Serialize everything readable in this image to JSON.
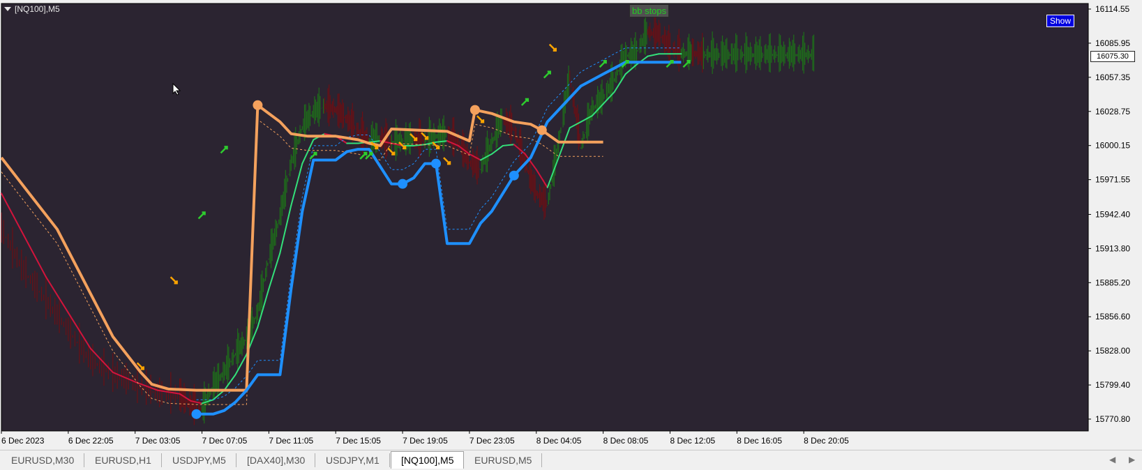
{
  "window": {
    "symbol_label": "[NQ100],M5"
  },
  "indicator_label": "bb stops",
  "show_button": "Show",
  "current_price": "16075.30",
  "colors": {
    "background": "#2b2431",
    "up_candle": "#1e6e1a",
    "down_candle": "#6b0f14",
    "upper_stop": "#f4a15d",
    "lower_stop": "#1e90ff",
    "mid_up": "#33e07a",
    "mid_down": "#d2143c",
    "arrow_up": "#2ecc2e",
    "arrow_down": "#ffa500"
  },
  "tabs": [
    {
      "label": "EURUSD,M30",
      "active": false
    },
    {
      "label": "EURUSD,H1",
      "active": false
    },
    {
      "label": "USDJPY,M5",
      "active": false
    },
    {
      "label": "[DAX40],M30",
      "active": false
    },
    {
      "label": "USDJPY,M1",
      "active": false
    },
    {
      "label": "[NQ100],M5",
      "active": true
    },
    {
      "label": "EURUSD,M5",
      "active": false
    }
  ],
  "chart_data": {
    "type": "line",
    "title": "[NQ100],M5",
    "y_ticks": [
      "16114.55",
      "16085.95",
      "16057.35",
      "16028.75",
      "16000.15",
      "15971.55",
      "15942.40",
      "15913.80",
      "15885.20",
      "15856.60",
      "15828.00",
      "15799.40",
      "15770.80"
    ],
    "x_ticks": [
      "6 Dec 2023",
      "6 Dec 22:05",
      "7 Dec 03:05",
      "7 Dec 07:05",
      "7 Dec 11:05",
      "7 Dec 15:05",
      "7 Dec 19:05",
      "7 Dec 23:05",
      "8 Dec 04:05",
      "8 Dec 08:05",
      "8 Dec 12:05",
      "8 Dec 16:05",
      "8 Dec 20:05"
    ],
    "ylim": [
      15765,
      16120
    ],
    "x_domain": [
      0,
      156
    ],
    "grid": false,
    "series": [
      {
        "key": "close",
        "x": [
          0,
          4,
          8,
          12,
          16,
          20,
          24,
          28,
          32,
          34,
          36,
          38,
          40,
          42,
          44,
          46,
          48,
          50,
          52,
          54,
          56,
          58,
          60,
          62,
          64,
          66,
          68,
          70,
          72,
          74,
          76,
          78,
          80,
          82,
          84,
          86,
          88,
          90,
          92,
          94,
          96,
          98,
          100,
          102,
          104,
          106,
          108,
          110,
          112,
          114,
          116,
          118,
          120,
          122,
          124,
          126,
          128,
          130,
          132,
          134,
          136,
          138,
          140,
          142,
          144,
          146
        ],
        "y": [
          15930,
          15895,
          15870,
          15845,
          15820,
          15808,
          15800,
          15792,
          15790,
          15782,
          15779,
          15798,
          15810,
          15825,
          15838,
          15860,
          15905,
          15940,
          15985,
          16015,
          16028,
          16033,
          16030,
          16022,
          16012,
          16004,
          16006,
          16002,
          16004,
          16005,
          16004,
          16008,
          16009,
          16003,
          15986,
          15980,
          16002,
          16022,
          16013,
          15985,
          15960,
          15950,
          16002,
          16058,
          15998,
          16030,
          16040,
          16055,
          16075,
          16078,
          16095,
          16093,
          16082,
          16077,
          16077,
          16076,
          16076,
          16076,
          16076,
          16076,
          16076,
          16076,
          16076,
          16076,
          16076,
          16076
        ]
      },
      {
        "key": "mid_line",
        "x": [
          0,
          4,
          8,
          12,
          16,
          20,
          24,
          28,
          32,
          34,
          36,
          38,
          40,
          42,
          44,
          46,
          48,
          50,
          52,
          54,
          56,
          58,
          60,
          62,
          64,
          66,
          68,
          70,
          72,
          74,
          76,
          78,
          80,
          82,
          84,
          86,
          88,
          90,
          92,
          94,
          96,
          98,
          100,
          102,
          104,
          106,
          108,
          110,
          112,
          114,
          116,
          118,
          120,
          122
        ],
        "y": [
          15960,
          15925,
          15890,
          15860,
          15830,
          15810,
          15802,
          15795,
          15792,
          15786,
          15784,
          15787,
          15795,
          15808,
          15825,
          15848,
          15880,
          15910,
          15950,
          15985,
          16005,
          16010,
          16008,
          16002,
          16002,
          16003,
          16004,
          16002,
          16000,
          16000,
          16001,
          16003,
          16004,
          16000,
          15993,
          15988,
          15993,
          16000,
          16001,
          15993,
          15980,
          15965,
          15990,
          16015,
          16020,
          16025,
          16035,
          16045,
          16060,
          16068,
          16075,
          16077,
          16077,
          16077
        ]
      },
      {
        "key": "upper_stop",
        "x": [
          0,
          5,
          10,
          15,
          20,
          25,
          27,
          30,
          35,
          38,
          40,
          42,
          44,
          46,
          50,
          52,
          55,
          60,
          64,
          66,
          68,
          70,
          75,
          80,
          84,
          85,
          88,
          92,
          95,
          97,
          100,
          102,
          105,
          108
        ],
        "y": [
          15990,
          15960,
          15930,
          15885,
          15840,
          15810,
          15800,
          15796,
          15795,
          15795,
          15795,
          15795,
          15795,
          16034,
          16020,
          16010,
          16008,
          16008,
          16005,
          16002,
          16000,
          16014,
          16013,
          16012,
          16004,
          16030,
          16027,
          16020,
          16018,
          16013,
          16003,
          16003,
          16003,
          16003
        ]
      },
      {
        "key": "lower_stop",
        "x": [
          35,
          38,
          40,
          42,
          44,
          46,
          48,
          50,
          52,
          54,
          56,
          58,
          60,
          62,
          64,
          66,
          70,
          72,
          74,
          76,
          78,
          80,
          82,
          84,
          86,
          88,
          90,
          92,
          95,
          98,
          100,
          102,
          104,
          106,
          108,
          110,
          112,
          114,
          116,
          118,
          120,
          122
        ],
        "y": [
          15775,
          15775,
          15778,
          15785,
          15795,
          15808,
          15808,
          15808,
          15880,
          15945,
          15988,
          15988,
          15988,
          15995,
          15997,
          15997,
          15968,
          15968,
          15973,
          15985,
          15985,
          15918,
          15918,
          15918,
          15935,
          15945,
          15960,
          15975,
          15990,
          16020,
          16030,
          16040,
          16050,
          16055,
          16060,
          16065,
          16070,
          16070,
          16070,
          16070,
          16070,
          16070
        ]
      }
    ]
  }
}
